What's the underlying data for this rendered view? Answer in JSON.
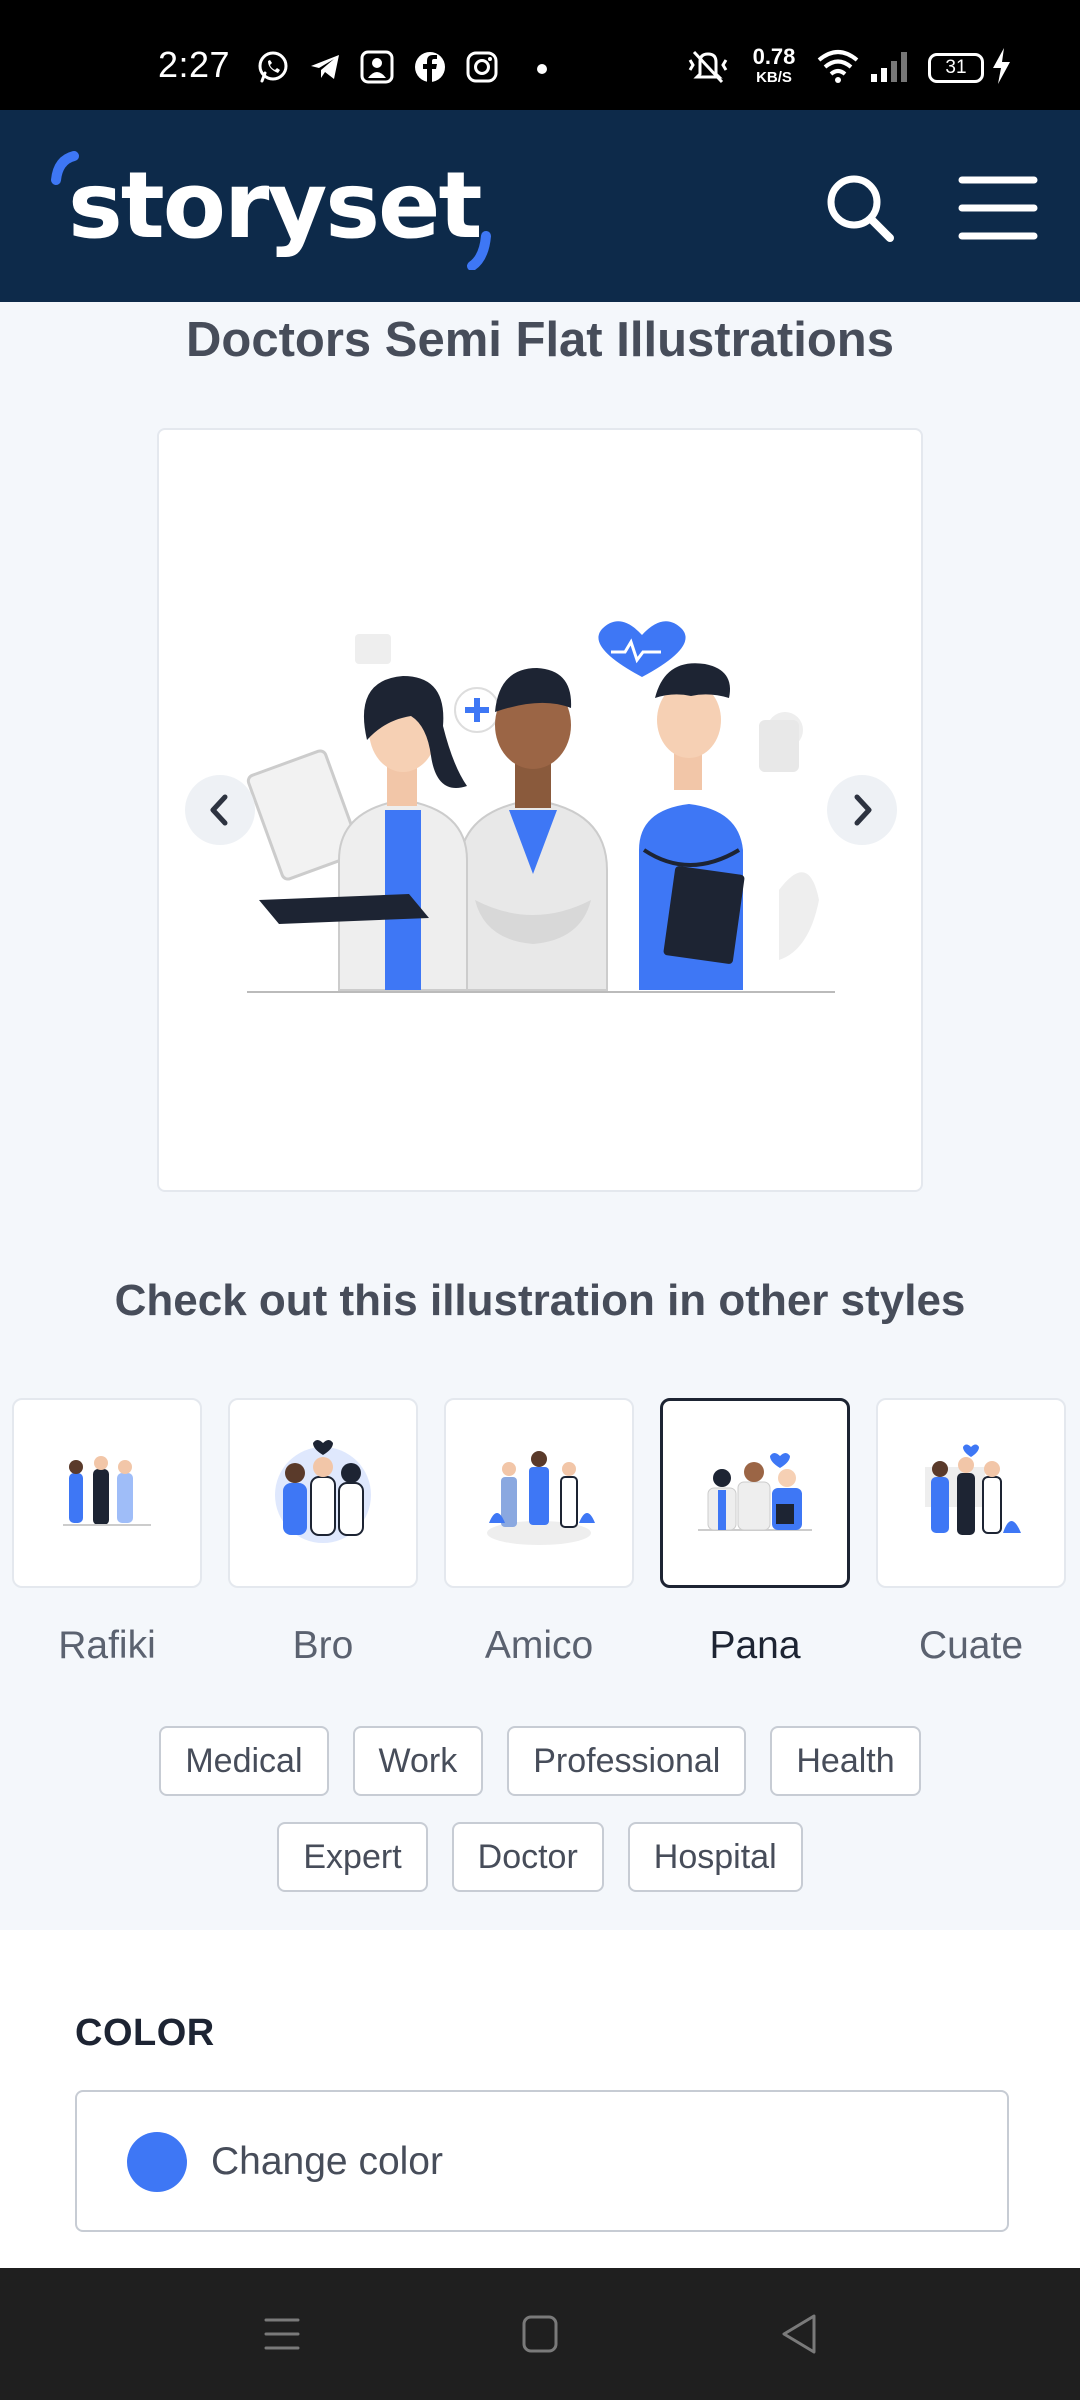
{
  "status_bar": {
    "time": "2:27",
    "app_icons": [
      "whatsapp-icon",
      "telegram-icon",
      "gallery-icon",
      "facebook-icon",
      "instagram-icon"
    ],
    "net_speed_value": "0.78",
    "net_speed_unit": "KB/S",
    "battery": "31"
  },
  "header": {
    "logo_text": "storyset",
    "brand_color": "#3e77f5",
    "search_icon": "search-icon",
    "menu_icon": "hamburger-menu-icon"
  },
  "main": {
    "title": "Doctors Semi Flat Illustrations",
    "carousel": {
      "prev_icon": "chevron-left-icon",
      "next_icon": "chevron-right-icon"
    },
    "styles_heading": "Check out this illustration in other styles",
    "styles": [
      {
        "label": "Rafiki",
        "active": false
      },
      {
        "label": "Bro",
        "active": false
      },
      {
        "label": "Amico",
        "active": false
      },
      {
        "label": "Pana",
        "active": true
      },
      {
        "label": "Cuate",
        "active": false
      }
    ],
    "tags_row1": [
      "Medical",
      "Work",
      "Professional",
      "Health"
    ],
    "tags_row2": [
      "Expert",
      "Doctor",
      "Hospital"
    ]
  },
  "color": {
    "heading": "COLOR",
    "button_label": "Change color",
    "swatch_color": "#3e77f5"
  },
  "nav_bar": {
    "buttons": [
      "recents-icon",
      "home-icon",
      "back-icon"
    ]
  }
}
